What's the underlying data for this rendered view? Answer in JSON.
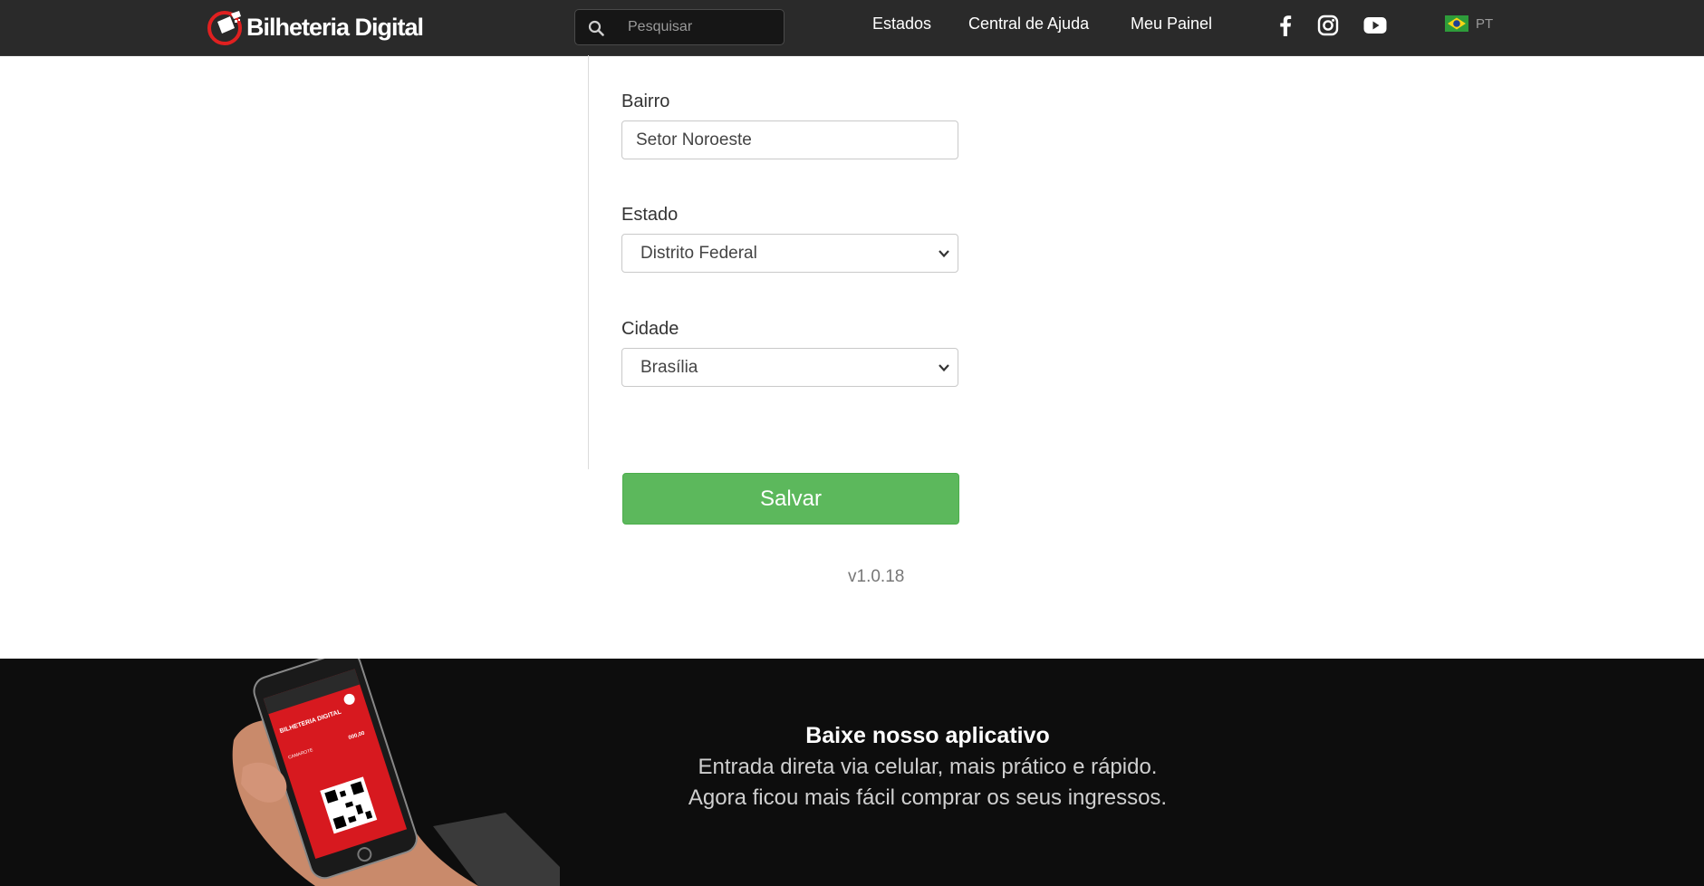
{
  "header": {
    "logo_text": "Bilheteria Digital",
    "search_placeholder": "Pesquisar",
    "nav": [
      {
        "label": "Estados"
      },
      {
        "label": "Central de Ajuda"
      },
      {
        "label": "Meu Painel"
      }
    ],
    "social_icons": [
      "facebook-icon",
      "instagram-icon",
      "youtube-icon"
    ],
    "language": {
      "flag": "brazil-flag-icon",
      "code": "PT"
    }
  },
  "form": {
    "bairro": {
      "label": "Bairro",
      "value": "Setor Noroeste"
    },
    "estado": {
      "label": "Estado",
      "value": "Distrito Federal"
    },
    "cidade": {
      "label": "Cidade",
      "value": "Brasília"
    },
    "save_label": "Salvar",
    "version": "v1.0.18"
  },
  "footer": {
    "title": "Baixe nosso aplicativo",
    "line1": "Entrada direta via celular, mais prático e rápido.",
    "line2": "Agora ficou mais fácil comprar os seus ingressos.",
    "phone_brand": "BILHETERIA DIGITAL",
    "phone_price": "000,00",
    "phone_label": "CAMAROTE"
  },
  "colors": {
    "header_bg": "#2a2a2a",
    "logo_accent": "#e02020",
    "save_button": "#5cb85c",
    "footer_bg": "#0d0d0d",
    "phone_screen": "#d7191f"
  }
}
